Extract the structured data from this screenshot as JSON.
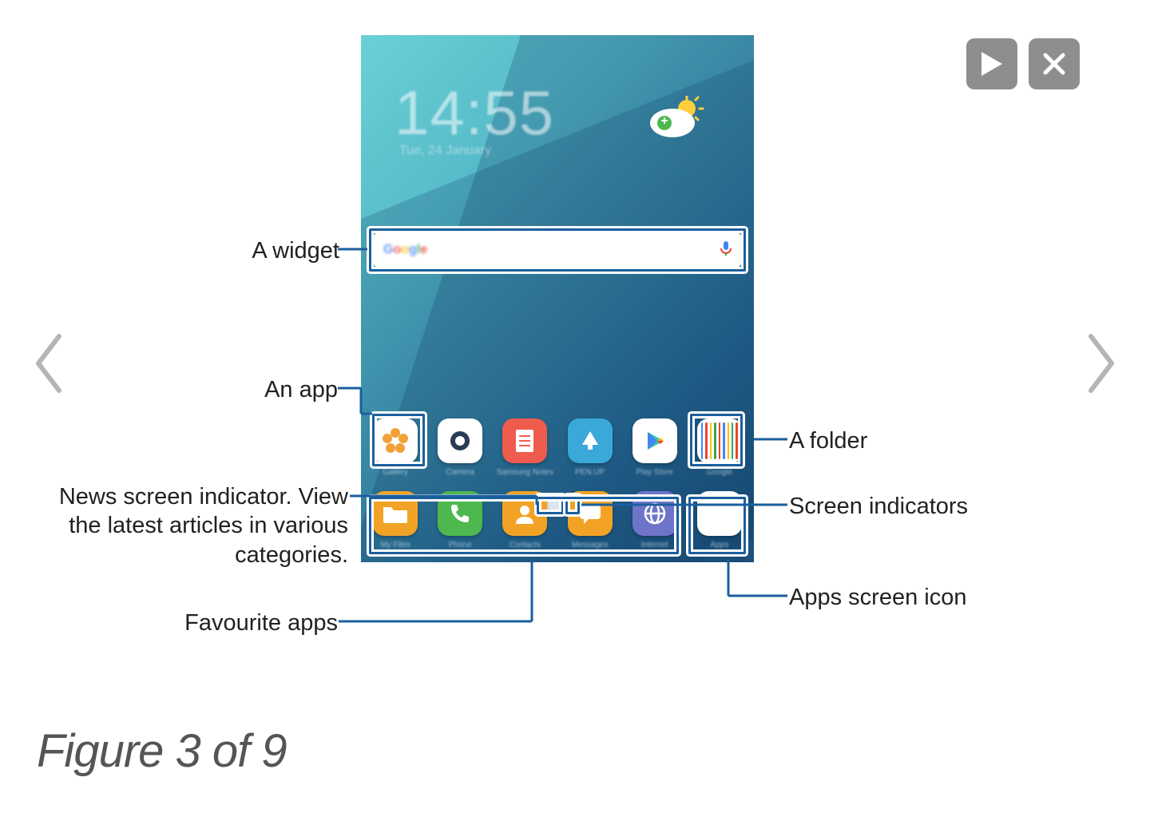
{
  "controls": {
    "play_icon_name": "play-icon",
    "close_icon_name": "close-icon"
  },
  "nav": {
    "prev_icon_name": "chevron-left-icon",
    "next_icon_name": "chevron-right-icon"
  },
  "caption": "Figure 3 of 9",
  "labels": {
    "widget": "A widget",
    "app": "An app",
    "news_indicator": "News screen indicator. View\nthe latest articles in various\ncategories.",
    "favourite_apps": "Favourite apps",
    "folder": "A folder",
    "screen_indicators": "Screen indicators",
    "apps_screen_icon": "Apps screen icon"
  },
  "tablet": {
    "clock": "14:55",
    "clock_sub": "Tue, 24 January",
    "search_logo": "Google",
    "apps": [
      {
        "name": "Gallery"
      },
      {
        "name": "Camera"
      },
      {
        "name": "Samsung Notes"
      },
      {
        "name": "PEN.UP"
      },
      {
        "name": "Play Store"
      },
      {
        "name": "Google"
      }
    ],
    "dock": [
      {
        "name": "My Files",
        "color": "#f2a325"
      },
      {
        "name": "Phone",
        "color": "#4eb84e"
      },
      {
        "name": "Contacts",
        "color": "#f2a325"
      },
      {
        "name": "Messages",
        "color": "#f2a325"
      },
      {
        "name": "Internet",
        "color": "#6f74c9"
      }
    ],
    "apps_icon_name": "Apps"
  }
}
